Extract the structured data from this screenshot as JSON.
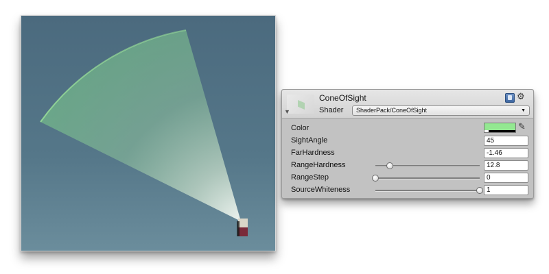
{
  "scene": {
    "sight_angle_deg": 45
  },
  "inspector": {
    "material_name": "ConeOfSight",
    "shader_label": "Shader",
    "shader_value": "ShaderPack/ConeOfSight",
    "properties": [
      {
        "label": "Color",
        "type": "color",
        "value": "#93e891"
      },
      {
        "label": "SightAngle",
        "type": "number",
        "value": "45"
      },
      {
        "label": "FarHardness",
        "type": "number",
        "value": "-1.46"
      },
      {
        "label": "RangeHardness",
        "type": "slider",
        "value": "12.8",
        "fraction": 0.14
      },
      {
        "label": "RangeStep",
        "type": "slider",
        "value": "0",
        "fraction": 0.0
      },
      {
        "label": "SourceWhiteness",
        "type": "slider",
        "value": "1",
        "fraction": 1.0
      }
    ]
  },
  "icons": {
    "help": "book-icon",
    "settings": "gear-icon",
    "eyedropper": "eyedropper-icon",
    "foldout": "triangle-down-icon"
  },
  "colors": {
    "cone_color": "#93e891",
    "viewport_bg": "#557789",
    "inspector_bg": "#c2c2c2"
  }
}
